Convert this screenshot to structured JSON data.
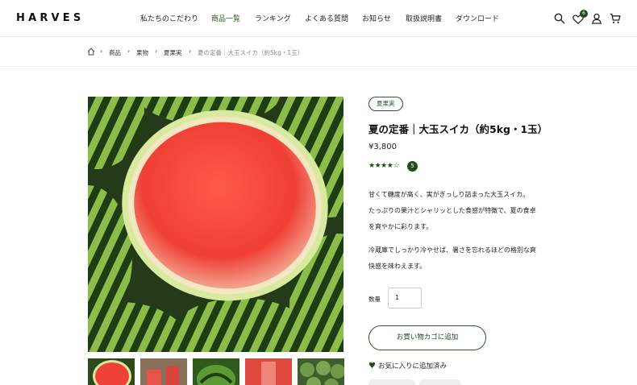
{
  "header": {
    "logo": "HARVES",
    "nav": [
      "私たちのこだわり",
      "商品一覧",
      "ランキング",
      "よくある質問",
      "お知らせ",
      "取扱説明書",
      "ダウンロード"
    ],
    "active_nav": "商品一覧",
    "wishlist_count": "6",
    "icons": [
      "search-icon",
      "heart-icon",
      "user-icon",
      "cart-icon"
    ]
  },
  "breadcrumb": {
    "items": [
      "商品",
      "果物",
      "夏果実"
    ],
    "current": "夏の定番｜大玉スイカ（約5kg・1玉）"
  },
  "product": {
    "tag": "夏果実",
    "title": "夏の定番｜大玉スイカ（約5kg・1玉）",
    "price": "¥3,800",
    "rating": 4,
    "rating_max": 5,
    "rating_count": "5",
    "description_lines": [
      "甘くて糖度が高く、実がぎっしり詰まった大玉スイカ。",
      "たっぷりの果汁とシャリッとした食感が特徴で、夏の食卓",
      "を爽やかに彩ります。",
      "冷蔵庫でしっかり冷やせば、暑さを忘れるほどの格別な爽",
      "快感を味わえます。"
    ],
    "quantity_label": "数量",
    "quantity_value": "1",
    "add_to_cart": "お買い物カゴに追加",
    "add_to_favorites": "お気に入りに追加済み"
  },
  "colors": {
    "accent": "#1f4d1c",
    "watermelon_flesh": "#f0473c",
    "rind": "#cfe39a"
  }
}
